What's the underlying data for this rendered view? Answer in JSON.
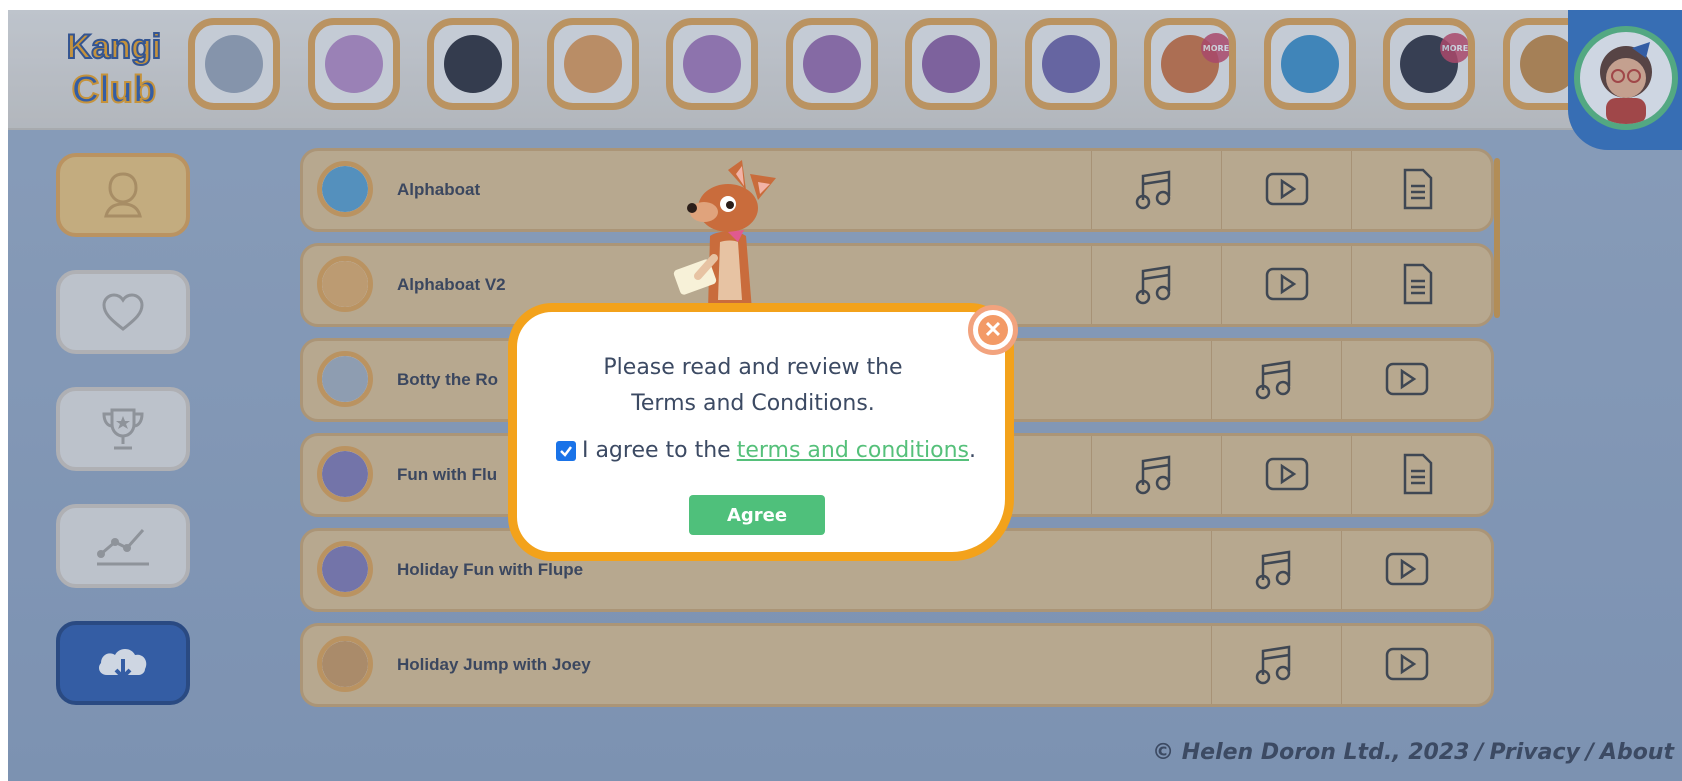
{
  "header": {
    "logo_text_top": "Kangi",
    "logo_text_bottom": "Club",
    "characters": [
      {
        "name": "robot-character",
        "color": "#9aa4b3",
        "badge": ""
      },
      {
        "name": "family-character",
        "color": "#b889c2",
        "badge": ""
      },
      {
        "name": "black-cat-character",
        "color": "#2a2a33",
        "badge": ""
      },
      {
        "name": "orange-cat-character",
        "color": "#e29a54",
        "badge": ""
      },
      {
        "name": "purple-dragon-character",
        "color": "#a677b6",
        "badge": ""
      },
      {
        "name": "purple-dragon-wand-character",
        "color": "#9a6aa9",
        "badge": ""
      },
      {
        "name": "purple-dragon-castle-character",
        "color": "#8f5fa0",
        "badge": ""
      },
      {
        "name": "purple-fluffy-character",
        "color": "#6f63a6",
        "badge": ""
      },
      {
        "name": "boy-and-fluffy-character",
        "color": "#d0703a",
        "badge": "MORE"
      },
      {
        "name": "boat-character",
        "color": "#3b8fc7",
        "badge": ""
      },
      {
        "name": "black-cat-more-character",
        "color": "#2f2f3a",
        "badge": "MORE"
      },
      {
        "name": "dog-number-two-character",
        "color": "#c7883f",
        "badge": ""
      }
    ]
  },
  "sidebar": {
    "items": [
      {
        "name": "sidebar-profile",
        "icon": "person-icon"
      },
      {
        "name": "sidebar-favorites",
        "icon": "heart-icon"
      },
      {
        "name": "sidebar-trophies",
        "icon": "trophy-icon"
      },
      {
        "name": "sidebar-progress",
        "icon": "progress-chart-icon"
      },
      {
        "name": "sidebar-download",
        "icon": "cloud-download-icon"
      }
    ]
  },
  "rows": [
    {
      "title": "Alphaboat",
      "thumb_color": "#3b8fc7",
      "icons": [
        "music-icon",
        "play-icon",
        "document-icon"
      ]
    },
    {
      "title": "Alphaboat V2",
      "thumb_color": "#e4a24d",
      "icons": [
        "music-icon",
        "play-icon",
        "document-icon"
      ]
    },
    {
      "title": "Botty the Ro",
      "thumb_color": "#9aa4b3",
      "icons": [
        "music-icon",
        "play-icon"
      ]
    },
    {
      "title": "Fun with Flu",
      "thumb_color": "#6f63a6",
      "icons": [
        "music-icon",
        "play-icon",
        "document-icon"
      ]
    },
    {
      "title": "Holiday Fun with Flupe",
      "thumb_color": "#6f63a6",
      "icons": [
        "music-icon",
        "play-icon"
      ]
    },
    {
      "title": "Holiday Jump with Joey",
      "thumb_color": "#c7883f",
      "icons": [
        "music-icon",
        "play-icon"
      ]
    }
  ],
  "modal": {
    "message_line1": "Please read and review the",
    "message_line2": "Terms and Conditions.",
    "agree_prefix": "I agree to the",
    "terms_link": "terms and conditions",
    "agree_suffix": ".",
    "agree_button": "Agree",
    "checkbox_checked": true
  },
  "footer": {
    "copyright": "© Helen Doron Ltd., 2023",
    "separator": "/",
    "privacy": "Privacy",
    "about": "About"
  },
  "colors": {
    "accent_orange": "#f3a21b",
    "agree_green": "#4fc07b",
    "link_green": "#55c07a",
    "text_dark": "#3c4a63"
  }
}
